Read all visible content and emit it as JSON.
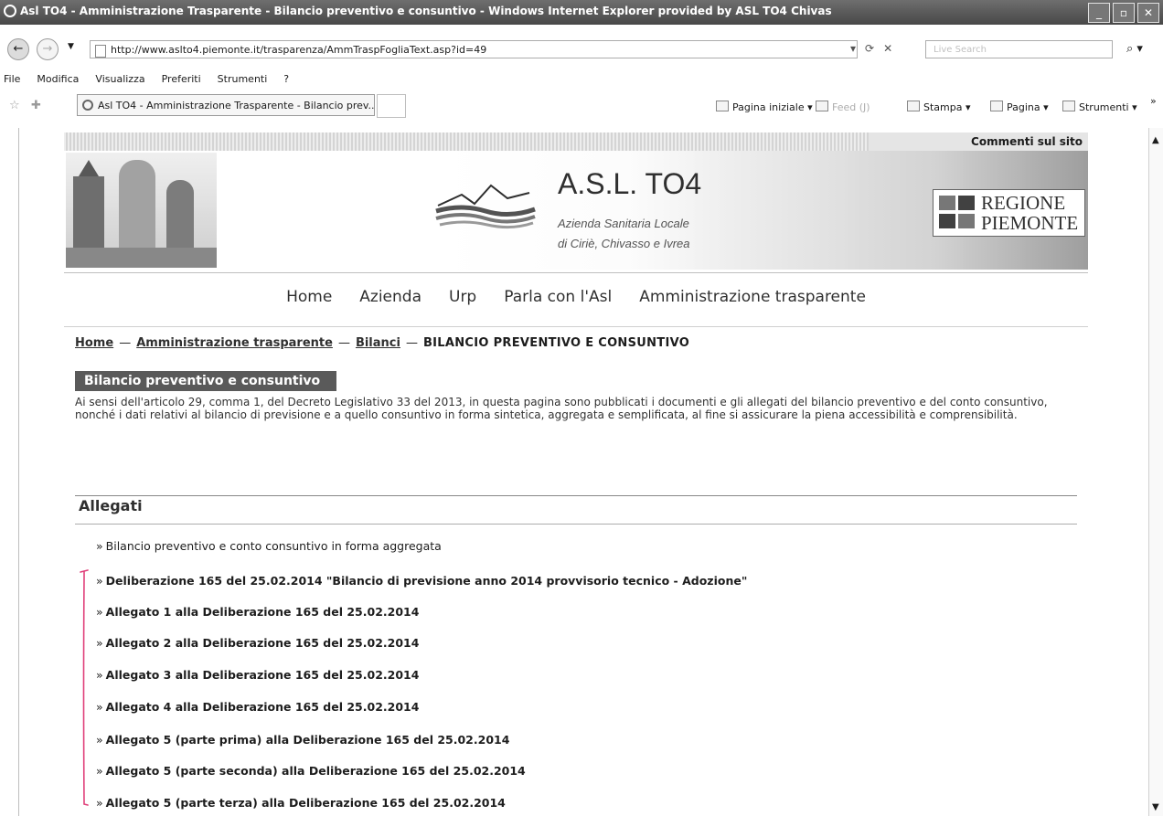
{
  "window": {
    "title": "Asl TO4 - Amministrazione Trasparente - Bilancio preventivo e consuntivo - Windows Internet Explorer provided by ASL TO4 Chivas"
  },
  "browser": {
    "url": "http://www.aslto4.piemonte.it/trasparenza/AmmTraspFogliaText.asp?id=49",
    "search_placeholder": "Live Search",
    "menu": [
      "File",
      "Modifica",
      "Visualizza",
      "Preferiti",
      "Strumenti",
      "?"
    ],
    "tab_title": "Asl TO4 - Amministrazione Trasparente - Bilancio prev...",
    "commands": {
      "home": "Pagina iniziale",
      "feed": "Feed (J)",
      "print": "Stampa",
      "page": "Pagina",
      "tools": "Strumenti"
    }
  },
  "site": {
    "commenti": "Commenti sul sito",
    "brand": "A.S.L. TO4",
    "subtitle1": "Azienda Sanitaria Locale",
    "subtitle2": "di Ciriè, Chivasso e Ivrea",
    "regione_line1": "REGIONE",
    "regione_line2": "PIEMONTE"
  },
  "nav": [
    "Home",
    "Azienda",
    "Urp",
    "Parla con l'Asl",
    "Amministrazione trasparente"
  ],
  "breadcrumb": {
    "home": "Home",
    "amm": "Amministrazione trasparente",
    "bilanci": "Bilanci",
    "current": "BILANCIO PREVENTIVO E CONSUNTIVO"
  },
  "section": {
    "title": "Bilancio preventivo e consuntivo",
    "intro": "Ai sensi dell'articolo 29, comma 1, del Decreto Legislativo 33 del 2013, in questa pagina sono pubblicati i documenti e gli allegati del bilancio preventivo e del conto consuntivo, nonché i dati relativi al bilancio di previsione e a quello consuntivo in forma sintetica, aggregata e semplificata, al fine si assicurare la piena accessibilità e comprensibilità."
  },
  "allegati": {
    "heading": "Allegati",
    "items": [
      "Bilancio preventivo e conto consuntivo in forma aggregata",
      "Deliberazione 165 del 25.02.2014 \"Bilancio di previsione anno 2014 provvisorio tecnico - Adozione\"",
      "Allegato 1 alla Deliberazione 165 del 25.02.2014",
      "Allegato 2 alla Deliberazione 165 del 25.02.2014",
      "Allegato 3 alla Deliberazione 165 del 25.02.2014",
      "Allegato 4 alla Deliberazione 165 del 25.02.2014",
      "Allegato 5 (parte prima) alla Deliberazione 165 del 25.02.2014",
      "Allegato 5 (parte seconda) alla Deliberazione 165 del 25.02.2014",
      "Allegato 5 (parte terza) alla Deliberazione 165 del 25.02.2014"
    ]
  },
  "annotation_color": "#e0407a"
}
